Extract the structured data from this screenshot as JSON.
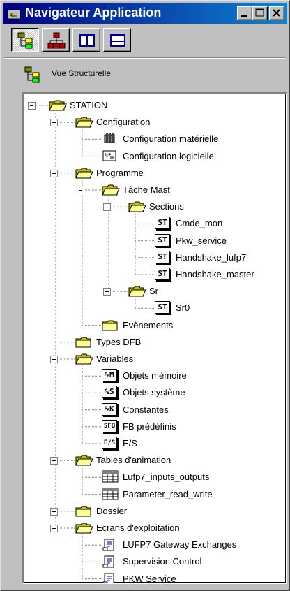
{
  "window": {
    "title": "Navigateur Application"
  },
  "titlebar_buttons": [
    "minimize-icon",
    "maximize-icon",
    "close-icon"
  ],
  "toolbar": [
    {
      "name": "structural-view-button",
      "icon": "tree-structure-icon",
      "pressed": true
    },
    {
      "name": "functional-view-button",
      "icon": "hierarchy-icon",
      "pressed": false
    },
    {
      "name": "split-vertical-button",
      "icon": "split-vertical-icon",
      "pressed": false
    },
    {
      "name": "split-horizontal-button",
      "icon": "split-horizontal-icon",
      "pressed": false
    }
  ],
  "view": {
    "label": "Vue Structurelle",
    "icon": "tree-structure-icon"
  },
  "colors": {
    "folder": "#ffff99",
    "folder_dark": "#c0c000",
    "title_start": "#000080",
    "title_end": "#1084d0"
  },
  "tree": [
    {
      "label": "STATION",
      "icon": "folder-open",
      "depth": 0,
      "expander": "minus",
      "children": [
        {
          "label": "Configuration",
          "icon": "folder-open",
          "depth": 1,
          "expander": "minus",
          "children": [
            {
              "label": "Configuration matérielle",
              "icon": "hardware-config",
              "depth": 2
            },
            {
              "label": "Configuration logicielle",
              "icon": "software-config",
              "depth": 2
            }
          ]
        },
        {
          "label": "Programme",
          "icon": "folder-open",
          "depth": 1,
          "expander": "minus",
          "children": [
            {
              "label": "Tâche Mast",
              "icon": "folder-open",
              "depth": 2,
              "expander": "minus",
              "children": [
                {
                  "label": "Sections",
                  "icon": "folder-open",
                  "depth": 3,
                  "expander": "minus",
                  "children": [
                    {
                      "label": "Cmde_mon",
                      "icon": "ST",
                      "depth": 4
                    },
                    {
                      "label": "Pkw_service",
                      "icon": "ST",
                      "depth": 4
                    },
                    {
                      "label": "Handshake_lufp7",
                      "icon": "ST",
                      "depth": 4
                    },
                    {
                      "label": "Handshake_master",
                      "icon": "ST",
                      "depth": 4
                    }
                  ]
                },
                {
                  "label": "Sr",
                  "icon": "folder-open",
                  "depth": 3,
                  "expander": "minus",
                  "children": [
                    {
                      "label": "Sr0",
                      "icon": "ST",
                      "depth": 4
                    }
                  ]
                }
              ]
            },
            {
              "label": "Evènements",
              "icon": "folder-closed",
              "depth": 2
            }
          ]
        },
        {
          "label": "Types DFB",
          "icon": "folder-closed",
          "depth": 1
        },
        {
          "label": "Variables",
          "icon": "folder-open",
          "depth": 1,
          "expander": "minus",
          "children": [
            {
              "label": "Objets mémoire",
              "icon": "%M",
              "depth": 2
            },
            {
              "label": "Objets système",
              "icon": "%S",
              "depth": 2
            },
            {
              "label": "Constantes",
              "icon": "%K",
              "depth": 2
            },
            {
              "label": "FB prédéfinis",
              "icon": "SFB",
              "depth": 2
            },
            {
              "label": "E/S",
              "icon": "E/S",
              "depth": 2
            }
          ]
        },
        {
          "label": "Tables d'animation",
          "icon": "folder-open",
          "depth": 1,
          "expander": "minus",
          "children": [
            {
              "label": "Lufp7_inputs_outputs",
              "icon": "table",
              "depth": 2
            },
            {
              "label": "Parameter_read_write",
              "icon": "table",
              "depth": 2
            }
          ]
        },
        {
          "label": "Dossier",
          "icon": "folder-closed",
          "depth": 1,
          "expander": "plus"
        },
        {
          "label": "Ecrans d'exploitation",
          "icon": "folder-open",
          "depth": 1,
          "expander": "minus",
          "children": [
            {
              "label": "LUFP7 Gateway Exchanges",
              "icon": "screen-doc",
              "depth": 2
            },
            {
              "label": "Supervision Control",
              "icon": "screen-doc",
              "depth": 2
            },
            {
              "label": "PKW Service",
              "icon": "screen-doc",
              "depth": 2
            }
          ]
        }
      ]
    }
  ]
}
